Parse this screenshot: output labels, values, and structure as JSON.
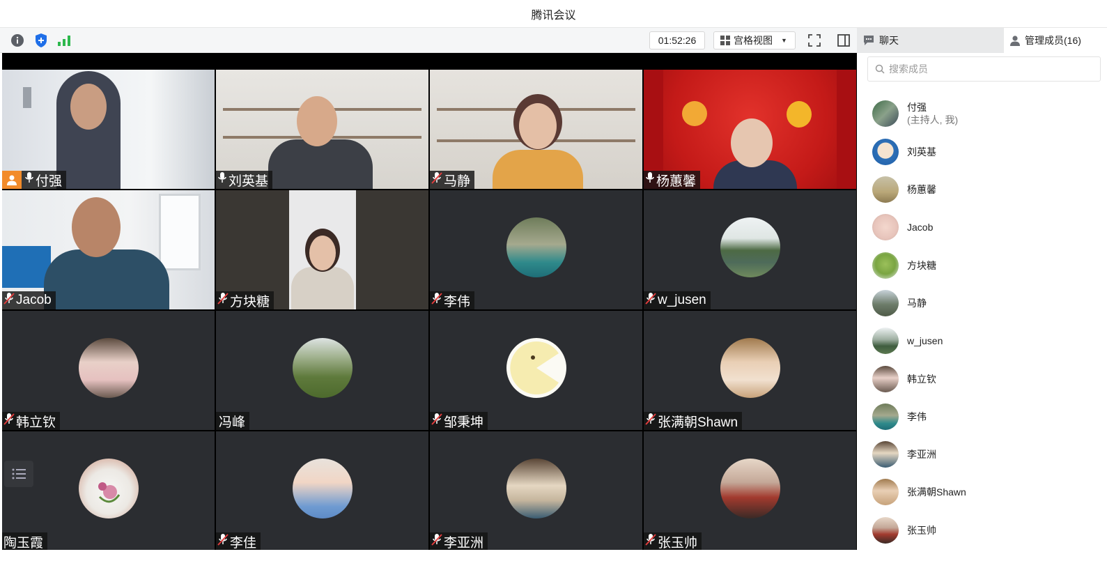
{
  "window": {
    "title": "腾讯会议"
  },
  "toolbar": {
    "timer": "01:52:26",
    "view_mode": "宫格视图",
    "chat_label": "聊天",
    "members_label": "管理成员(16)",
    "icons": [
      "info-icon",
      "shield-icon",
      "signal-icon",
      "fullscreen-icon",
      "sidebar-toggle-icon",
      "chat-icon",
      "member-icon"
    ],
    "colors": {
      "shield": "#1f6fe8",
      "signal": "#2db84d",
      "host_badge": "#f28b2a"
    }
  },
  "grid": {
    "tiles": [
      {
        "name": "付强",
        "mic": "on",
        "host": true,
        "kind": "video"
      },
      {
        "name": "刘英基",
        "mic": "on",
        "host": false,
        "kind": "video"
      },
      {
        "name": "马静",
        "mic": "muted",
        "host": false,
        "kind": "video"
      },
      {
        "name": "杨蕙馨",
        "mic": "on",
        "host": false,
        "kind": "video"
      },
      {
        "name": "Jacob",
        "mic": "muted",
        "host": false,
        "kind": "video"
      },
      {
        "name": "方块糖",
        "mic": "muted",
        "host": false,
        "kind": "video"
      },
      {
        "name": "李伟",
        "mic": "muted",
        "host": false,
        "kind": "avatar"
      },
      {
        "name": "w_jusen",
        "mic": "muted",
        "host": false,
        "kind": "avatar"
      },
      {
        "name": "韩立钦",
        "mic": "muted",
        "host": false,
        "kind": "avatar"
      },
      {
        "name": "冯峰",
        "mic": "none",
        "host": false,
        "kind": "avatar"
      },
      {
        "name": "邹秉坤",
        "mic": "muted",
        "host": false,
        "kind": "avatar"
      },
      {
        "name": "张满朝Shawn",
        "mic": "muted",
        "host": false,
        "kind": "avatar"
      },
      {
        "name": "陶玉霞",
        "mic": "none",
        "host": false,
        "kind": "avatar"
      },
      {
        "name": "李佳",
        "mic": "muted",
        "host": false,
        "kind": "avatar"
      },
      {
        "name": "李亚洲",
        "mic": "muted",
        "host": false,
        "kind": "avatar"
      },
      {
        "name": "张玉帅",
        "mic": "muted",
        "host": false,
        "kind": "avatar"
      }
    ]
  },
  "sidebar": {
    "search_placeholder": "搜索成员",
    "members": [
      {
        "name": "付强",
        "role": "(主持人, 我)"
      },
      {
        "name": "刘英基"
      },
      {
        "name": "杨蕙馨"
      },
      {
        "name": "Jacob"
      },
      {
        "name": "方块糖"
      },
      {
        "name": "马静"
      },
      {
        "name": "w_jusen"
      },
      {
        "name": "韩立钦"
      },
      {
        "name": "李伟"
      },
      {
        "name": "李亚洲"
      },
      {
        "name": "张满朝Shawn"
      },
      {
        "name": "张玉帅"
      }
    ]
  }
}
